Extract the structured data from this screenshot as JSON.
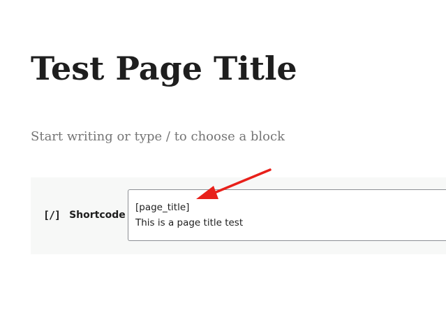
{
  "post": {
    "title": "Test Page Title",
    "empty_block_placeholder": "Start writing or type / to choose a block"
  },
  "shortcode_block": {
    "icon_glyph": "[/]",
    "icon_name": "shortcode-icon",
    "label": "Shortcode",
    "content_lines": [
      "[page_title]",
      "This is a page title test"
    ]
  },
  "annotation": {
    "type": "arrow",
    "color": "#e8201a"
  }
}
